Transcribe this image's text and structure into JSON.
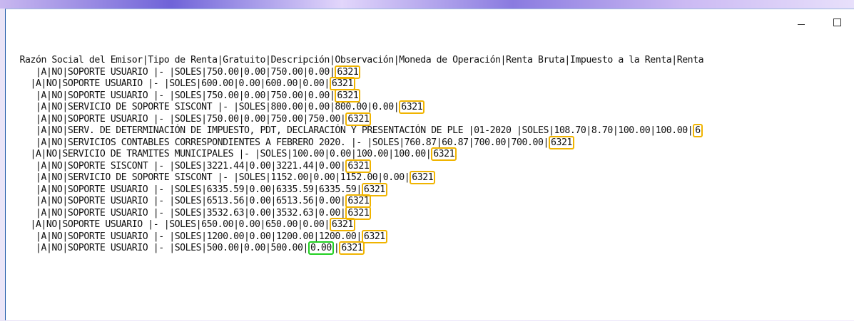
{
  "window": {
    "controls": {
      "minimize_icon": "minimize-icon",
      "maximize_icon": "maximize-icon"
    }
  },
  "header_line": " Razón Social del Emisor|Tipo de Renta|Gratuito|Descripción|Observación|Moneda de Operación|Renta Bruta|Impuesto a la Renta|Renta",
  "rows": [
    {
      "indent": "    ",
      "text": "|A|NO|SOPORTE USUARIO |- |SOLES|750.00|0.00|750.00|0.00|",
      "code": "6321",
      "green": "",
      "after_green": ""
    },
    {
      "indent": "   ",
      "text": "|A|NO|SOPORTE USUARIO |- |SOLES|600.00|0.00|600.00|0.00|",
      "code": "6321",
      "green": "",
      "after_green": ""
    },
    {
      "indent": "    ",
      "text": "|A|NO|SOPORTE USUARIO |- |SOLES|750.00|0.00|750.00|0.00|",
      "code": "6321",
      "green": "",
      "after_green": ""
    },
    {
      "indent": "    ",
      "text": "|A|NO|SERVICIO DE SOPORTE SISCONT |- |SOLES|800.00|0.00|800.00|0.00|",
      "code": "6321",
      "green": "",
      "after_green": ""
    },
    {
      "indent": "    ",
      "text": "|A|NO|SOPORTE USUARIO |- |SOLES|750.00|0.00|750.00|750.00|",
      "code": "6321",
      "green": "",
      "after_green": ""
    },
    {
      "indent": "    ",
      "text": "|A|NO|SERV. DE DETERMINACIÓN DE IMPUESTO, PDT, DECLARACIÓN Y PRESENTACIÓN DE PLE |01-2020 |SOLES|108.70|8.70|100.00|100.00|",
      "code": "6",
      "green": "",
      "after_green": ""
    },
    {
      "indent": "    ",
      "text": "|A|NO|SERVICIOS CONTABLES CORRESPONDIENTES A FEBRERO 2020. |- |SOLES|760.87|60.87|700.00|700.00|",
      "code": "6321",
      "green": "",
      "after_green": ""
    },
    {
      "indent": "   ",
      "text": "|A|NO|SERVICIO DE TRAMITES MUNICIPALES |- |SOLES|100.00|0.00|100.00|100.00|",
      "code": "6321",
      "green": "",
      "after_green": ""
    },
    {
      "indent": "    ",
      "text": "|A|NO|SOPORTE SISCONT |- |SOLES|3221.44|0.00|3221.44|0.00|",
      "code": "6321",
      "green": "",
      "after_green": ""
    },
    {
      "indent": "    ",
      "text": "|A|NO|SERVICIO DE SOPORTE SISCONT |- |SOLES|1152.00|0.00|1152.00|0.00|",
      "code": "6321",
      "green": "",
      "after_green": ""
    },
    {
      "indent": "    ",
      "text": "|A|NO|SOPORTE USUARIO |- |SOLES|6335.59|0.00|6335.59|6335.59|",
      "code": "6321",
      "green": "",
      "after_green": ""
    },
    {
      "indent": "    ",
      "text": "|A|NO|SOPORTE USUARIO |- |SOLES|6513.56|0.00|6513.56|0.00|",
      "code": "6321",
      "green": "",
      "after_green": ""
    },
    {
      "indent": "    ",
      "text": "|A|NO|SOPORTE USUARIO |- |SOLES|3532.63|0.00|3532.63|0.00|",
      "code": "6321",
      "green": "",
      "after_green": ""
    },
    {
      "indent": "   ",
      "text": "|A|NO|SOPORTE USUARIO |- |SOLES|650.00|0.00|650.00|0.00|",
      "code": "6321",
      "green": "",
      "after_green": ""
    },
    {
      "indent": "    ",
      "text": "|A|NO|SOPORTE USUARIO |- |SOLES|1200.00|0.00|1200.00|1200.00|",
      "code": "6321",
      "green": "",
      "after_green": ""
    },
    {
      "indent": "    ",
      "text": "|A|NO|SOPORTE USUARIO |- |SOLES|500.00|0.00|500.00|",
      "code": "6321",
      "green": "0.00",
      "after_green": "|"
    }
  ],
  "colors": {
    "highlight_orange": "#f0b400",
    "highlight_green": "#20d020",
    "window_border": "#1e5aa8"
  }
}
